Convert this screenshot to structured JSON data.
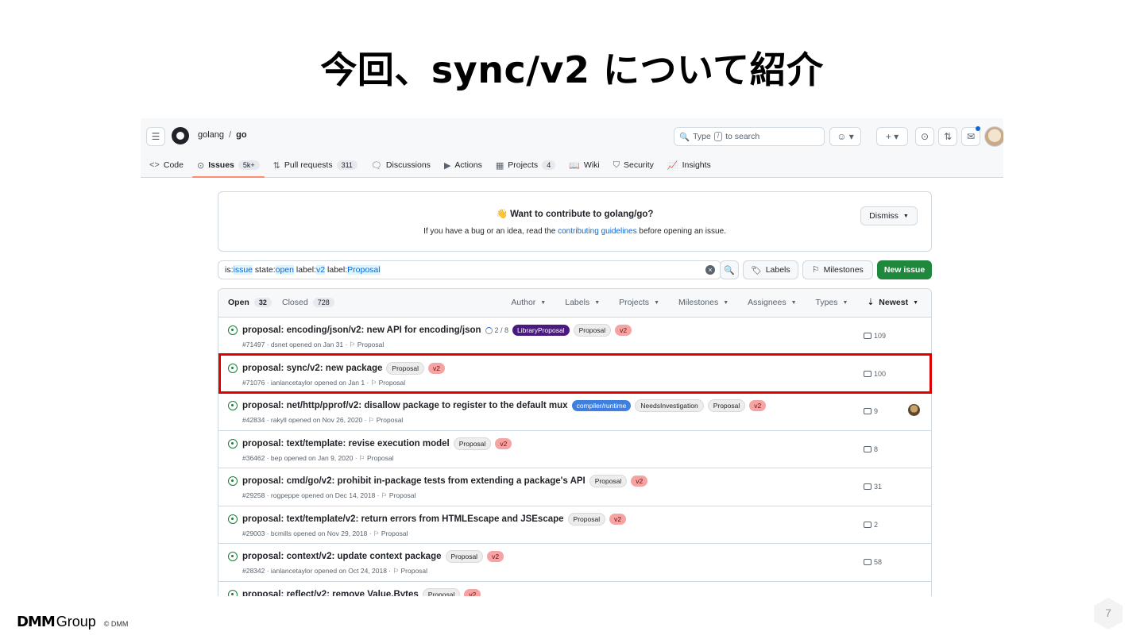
{
  "slide": {
    "title": "今回、sync/v2 について紹介",
    "page_number": "7",
    "footer": {
      "logo_dmm": "DMM",
      "logo_group": "Group",
      "copyright": "© DMM"
    }
  },
  "header": {
    "owner": "golang",
    "separator": "/",
    "repo": "go",
    "search_placeholder_pre": "Type",
    "search_key": "/",
    "search_placeholder_post": "to search"
  },
  "tabs": [
    {
      "label": "Code",
      "icon": "code-icon",
      "glyph": "<>"
    },
    {
      "label": "Issues",
      "count": "5k+",
      "icon": "issue-icon",
      "glyph": "⊙",
      "active": true
    },
    {
      "label": "Pull requests",
      "count": "311",
      "icon": "pull-request-icon",
      "glyph": "⇅"
    },
    {
      "label": "Discussions",
      "icon": "discussions-icon",
      "glyph": "🗨"
    },
    {
      "label": "Actions",
      "icon": "play-icon",
      "glyph": "▶"
    },
    {
      "label": "Projects",
      "count": "4",
      "icon": "table-icon",
      "glyph": "▦"
    },
    {
      "label": "Wiki",
      "icon": "book-icon",
      "glyph": "📖"
    },
    {
      "label": "Security",
      "icon": "shield-icon",
      "glyph": "⛉"
    },
    {
      "label": "Insights",
      "icon": "graph-icon",
      "glyph": "📈"
    }
  ],
  "banner": {
    "emoji": "👋",
    "title": "Want to contribute to golang/go?",
    "sub_pre": "If you have a bug or an idea, read the",
    "sub_link": "contributing guidelines",
    "sub_post": "before opening an issue.",
    "dismiss": "Dismiss"
  },
  "filter": {
    "query_parts": [
      {
        "t": "is:",
        "hl": false
      },
      {
        "t": "issue",
        "hl": true
      },
      {
        "t": " state:",
        "hl": false
      },
      {
        "t": "open",
        "hl": true
      },
      {
        "t": " label:",
        "hl": false
      },
      {
        "t": "v2",
        "hl": true
      },
      {
        "t": " label:",
        "hl": false
      },
      {
        "t": "Proposal",
        "hl": true
      }
    ],
    "labels_btn": "Labels",
    "milestones_btn": "Milestones",
    "new_issue_btn": "New issue"
  },
  "list_header": {
    "open_label": "Open",
    "open_count": "32",
    "closed_label": "Closed",
    "closed_count": "728",
    "filters": [
      "Author",
      "Labels",
      "Projects",
      "Milestones",
      "Assignees",
      "Types"
    ],
    "sort": "Newest"
  },
  "issues": [
    {
      "title": "proposal: encoding/json/v2: new API for encoding/json",
      "tasks": "2 / 8",
      "labels": [
        {
          "name": "LibraryProposal",
          "kind": "library"
        },
        {
          "name": "Proposal",
          "kind": "proposal"
        },
        {
          "name": "v2",
          "kind": "v2"
        }
      ],
      "meta": "#71497 · dsnet opened on Jan 31 · ",
      "milestone": "Proposal",
      "comments": "109",
      "assignee": false
    },
    {
      "title": "proposal: sync/v2: new package",
      "labels": [
        {
          "name": "Proposal",
          "kind": "proposal"
        },
        {
          "name": "v2",
          "kind": "v2"
        }
      ],
      "meta": "#71076 · ianlancetaylor opened on Jan 1 · ",
      "milestone": "Proposal",
      "comments": "100",
      "assignee": false
    },
    {
      "title": "proposal: net/http/pprof/v2: disallow package to register to the default mux",
      "labels": [
        {
          "name": "compiler/runtime",
          "kind": "compiler"
        },
        {
          "name": "NeedsInvestigation",
          "kind": "needs"
        },
        {
          "name": "Proposal",
          "kind": "proposal"
        },
        {
          "name": "v2",
          "kind": "v2"
        }
      ],
      "meta": "#42834 · rakyll opened on Nov 26, 2020 · ",
      "milestone": "Proposal",
      "comments": "9",
      "assignee": true
    },
    {
      "title": "proposal: text/template: revise execution model",
      "labels": [
        {
          "name": "Proposal",
          "kind": "proposal"
        },
        {
          "name": "v2",
          "kind": "v2"
        }
      ],
      "meta": "#36462 · bep opened on Jan 9, 2020 · ",
      "milestone": "Proposal",
      "comments": "8",
      "assignee": false
    },
    {
      "title": "proposal: cmd/go/v2: prohibit in-package tests from extending a package's API",
      "labels": [
        {
          "name": "Proposal",
          "kind": "proposal"
        },
        {
          "name": "v2",
          "kind": "v2"
        }
      ],
      "meta": "#29258 · rogpeppe opened on Dec 14, 2018 · ",
      "milestone": "Proposal",
      "comments": "31",
      "assignee": false
    },
    {
      "title": "proposal: text/template/v2: return errors from HTMLEscape and JSEscape",
      "labels": [
        {
          "name": "Proposal",
          "kind": "proposal"
        },
        {
          "name": "v2",
          "kind": "v2"
        }
      ],
      "meta": "#29003 · bcmills opened on Nov 29, 2018 · ",
      "milestone": "Proposal",
      "comments": "2",
      "assignee": false
    },
    {
      "title": "proposal: context/v2: update context package",
      "labels": [
        {
          "name": "Proposal",
          "kind": "proposal"
        },
        {
          "name": "v2",
          "kind": "v2"
        }
      ],
      "meta": "#28342 · ianlancetaylor opened on Oct 24, 2018 · ",
      "milestone": "Proposal",
      "comments": "58",
      "assignee": false
    },
    {
      "title": "proposal: reflect/v2: remove Value.Bytes",
      "labels": [
        {
          "name": "Proposal",
          "kind": "proposal"
        },
        {
          "name": "v2",
          "kind": "v2"
        }
      ],
      "meta": "",
      "milestone": "",
      "comments": "",
      "assignee": false
    }
  ]
}
